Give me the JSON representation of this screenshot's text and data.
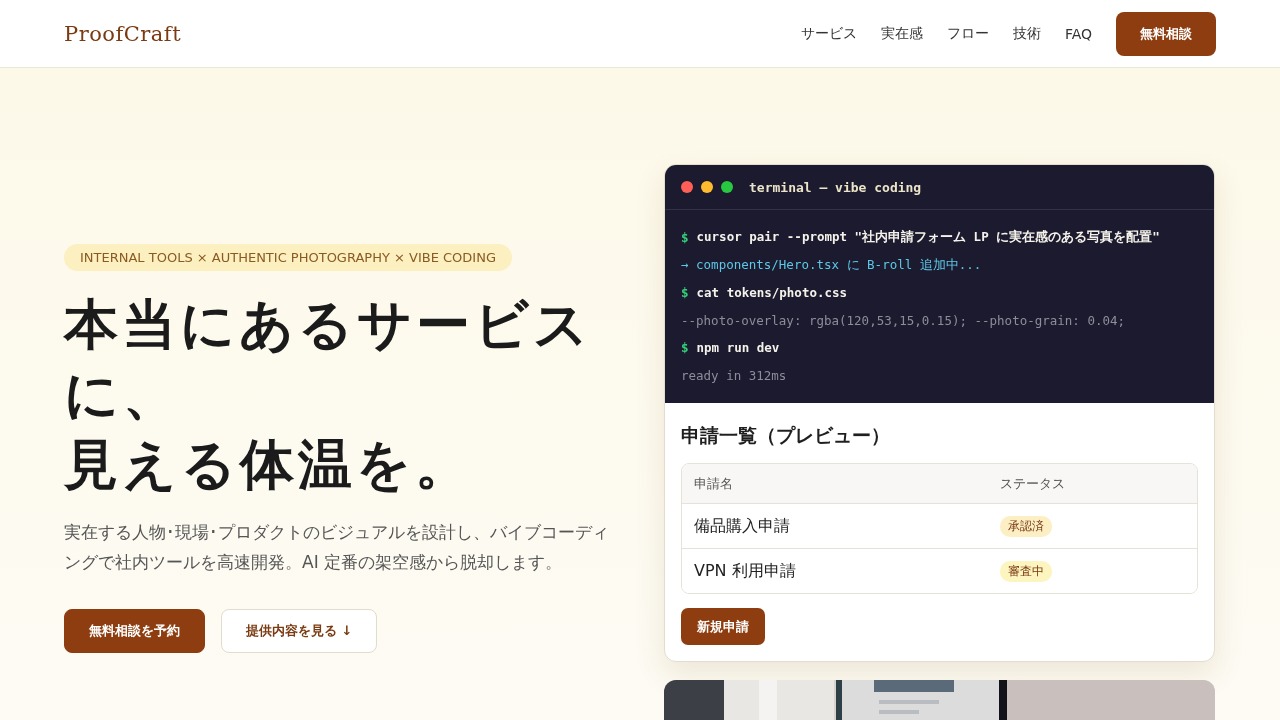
{
  "header": {
    "logo": "ProofCraft",
    "nav": [
      "サービス",
      "実在感",
      "フロー",
      "技術",
      "FAQ"
    ],
    "cta": "無料相談"
  },
  "hero": {
    "eyebrow": "INTERNAL TOOLS × AUTHENTIC PHOTOGRAPHY × VIBE CODING",
    "headline": [
      "本当にあるサービス",
      "に、",
      "見える体温を。"
    ],
    "lead": "実在する人物･現場･プロダクトのビジュアルを設計し、バイブコーディングで社内ツールを高速開発。AI 定番の架空感から脱却します。",
    "buttons": [
      {
        "label": "無料相談を予約",
        "kind": "primary"
      },
      {
        "label": "提供内容を見る ↓",
        "kind": "secondary"
      }
    ]
  },
  "terminal": {
    "title": "terminal — vibe coding",
    "lines": [
      {
        "kind": "command",
        "prompt": "$",
        "text": "cursor pair --prompt \"社内申請フォーム LP に実在感のある写真を配置\""
      },
      {
        "kind": "info",
        "text": "→ components/Hero.tsx に B-roll 追加中..."
      },
      {
        "kind": "command",
        "prompt": "$",
        "text": "cat tokens/photo.css"
      },
      {
        "kind": "output",
        "text": "--photo-overlay: rgba(120,53,15,0.15); --photo-grain: 0.04;"
      },
      {
        "kind": "command",
        "prompt": "$",
        "text": "npm run dev"
      },
      {
        "kind": "output",
        "text": "ready in 312ms"
      }
    ]
  },
  "preview": {
    "title": "申請一覧（プレビュー）",
    "columns": [
      "申請名",
      "ステータス"
    ],
    "rows": [
      {
        "name": "備品購入申請",
        "status": "承認済",
        "color": "#fdefc4"
      },
      {
        "name": "VPN 利用申請",
        "status": "審査中",
        "color": "#fdf5bf"
      }
    ],
    "button": "新規申請"
  }
}
